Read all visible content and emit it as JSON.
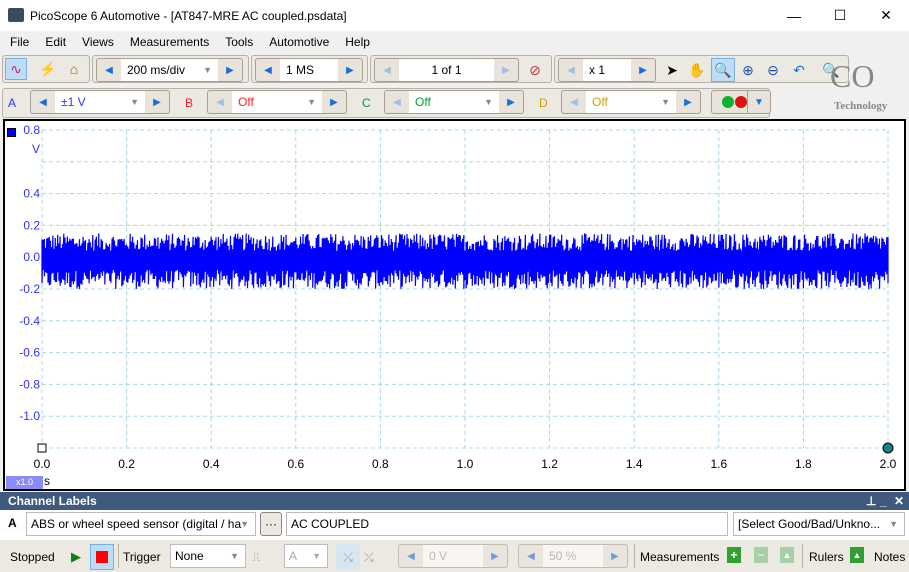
{
  "window": {
    "title": "PicoScope 6 Automotive - [AT847-MRE AC coupled.psdata]",
    "minimize": "—",
    "maximize": "☐",
    "close": "✕"
  },
  "menu": [
    "File",
    "Edit",
    "Views",
    "Measurements",
    "Tools",
    "Automotive",
    "Help"
  ],
  "toolbar": {
    "timebase": "200 ms/div",
    "samples": "1 MS",
    "buffer": "1 of 1",
    "zoom": "x 1",
    "active_tool": "zoom-select",
    "logo": "Technology"
  },
  "channels": [
    {
      "letter": "A",
      "range": "±1 V",
      "color": "#3030ff"
    },
    {
      "letter": "B",
      "range": "Off",
      "color": "#ff2020"
    },
    {
      "letter": "C",
      "range": "Off",
      "color": "#00a040"
    },
    {
      "letter": "D",
      "range": "Off",
      "color": "#d0a000"
    }
  ],
  "chart_data": {
    "type": "line",
    "xlabel": "s",
    "ylabel": "V",
    "xlim": [
      0,
      2.0
    ],
    "ylim": [
      -1.2,
      0.8
    ],
    "x_ticks": [
      "0.0",
      "0.2",
      "0.4",
      "0.6",
      "0.8",
      "1.0",
      "1.2",
      "1.4",
      "1.6",
      "1.8",
      "2.0"
    ],
    "y_ticks": [
      "0.8",
      "0.4",
      "0.2",
      "0.0",
      "-0.2",
      "-0.4",
      "-0.6",
      "-0.8",
      "-1.0"
    ],
    "grid": true,
    "series": [
      {
        "channel": "A",
        "color": "#0000ff",
        "description_range": [
          -0.2,
          0.15
        ]
      }
    ],
    "zoom_badge": "x1.0"
  },
  "channel_labels": {
    "title": "Channel Labels",
    "channel": "A",
    "sensor": "ABS or wheel speed sensor (digital / ha",
    "ellipsis": "···",
    "label": "AC COUPLED",
    "verdict": "[Select Good/Bad/Unkno..."
  },
  "statusbar": {
    "state": "Stopped",
    "trigger_label": "Trigger",
    "trigger_mode": "None",
    "trigger_channel": "A",
    "threshold": "0 V",
    "pretrigger": "50 %",
    "measurements": "Measurements",
    "rulers": "Rulers",
    "notes": "Notes"
  }
}
